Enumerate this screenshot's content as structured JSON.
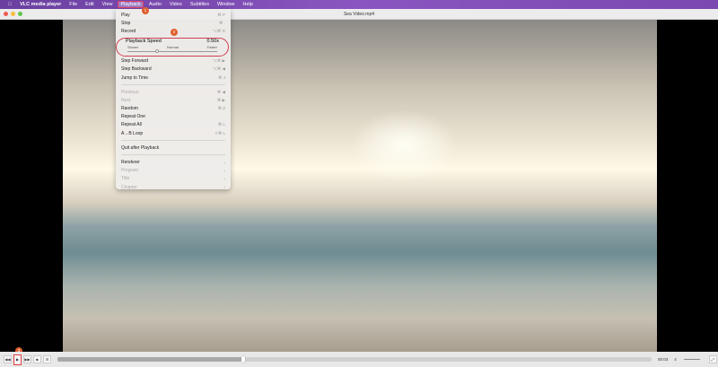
{
  "menubar": {
    "apple_icon": "apple-icon",
    "app": "VLC media player",
    "items": [
      "File",
      "Edit",
      "View",
      "Playback",
      "Audio",
      "Video",
      "Subtitles",
      "Window",
      "Help"
    ]
  },
  "window": {
    "title": "Sea Video.mp4"
  },
  "menu": {
    "group1": [
      {
        "label": "Play",
        "shortcut": "⌘ P"
      },
      {
        "label": "Stop",
        "shortcut": "⌘ ."
      },
      {
        "label": "Record",
        "shortcut": "⌥⌘ R"
      }
    ],
    "speed": {
      "label": "Playback Speed",
      "value": "0.50x",
      "slower": "Slower",
      "normal": "Normal",
      "faster": "Faster",
      "level_fraction": 0.31
    },
    "group2": [
      {
        "label": "Step Forward",
        "shortcut": "⌥⌘ ▶"
      },
      {
        "label": "Step Backward",
        "shortcut": "⌥⌘ ◀"
      },
      {
        "label": "Jump to Time",
        "shortcut": "⌘ J"
      }
    ],
    "group3": [
      {
        "label": "Previous",
        "shortcut": "⌘ ◀",
        "disabled": true
      },
      {
        "label": "Next",
        "shortcut": "⌘ ▶",
        "disabled": true
      },
      {
        "label": "Random",
        "shortcut": "⌘ Z"
      },
      {
        "label": "Repeat One",
        "shortcut": ""
      },
      {
        "label": "Repeat All",
        "shortcut": "⌘ L"
      },
      {
        "label": "A→B Loop",
        "shortcut": "⇧⌘ L"
      }
    ],
    "group4": [
      {
        "label": "Quit after Playback"
      }
    ],
    "group5": [
      {
        "label": "Renderer",
        "disabled": false
      },
      {
        "label": "Program",
        "disabled": true
      },
      {
        "label": "Title",
        "disabled": true
      },
      {
        "label": "Chapter",
        "disabled": true
      }
    ]
  },
  "badges": [
    "1",
    "2",
    "3"
  ],
  "controls": {
    "time": "00:03",
    "progress_fraction": 0.31,
    "volume_label": "4"
  },
  "colors": {
    "menubar": "#7a48b0",
    "highlight": "#e04050",
    "badge": "#e06030"
  }
}
